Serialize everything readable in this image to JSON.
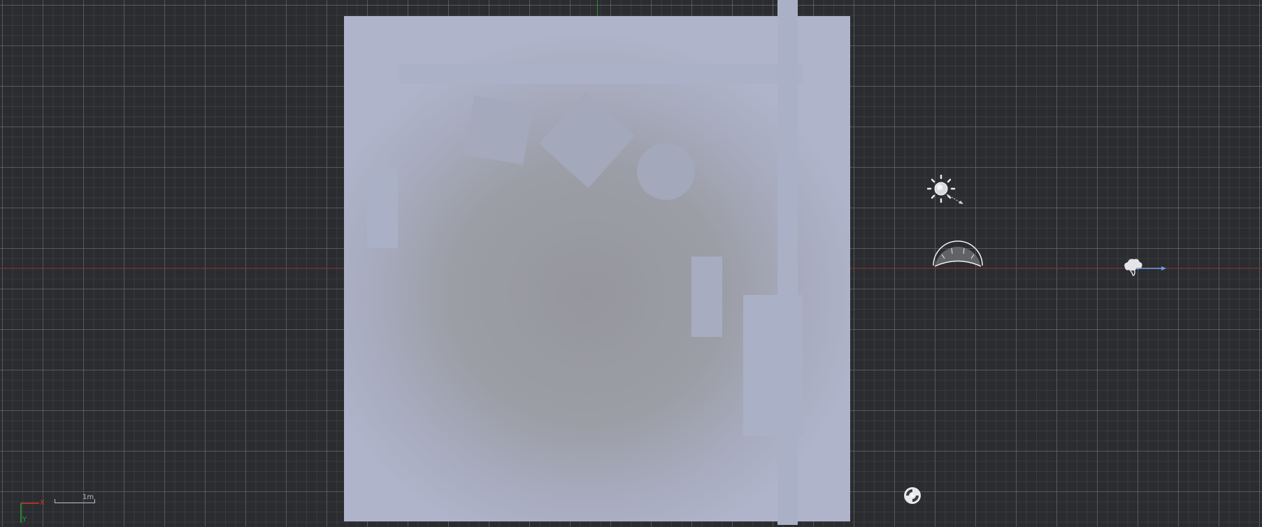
{
  "viewport": {
    "grid": "on",
    "colors": {
      "background": "#2b2c2f",
      "grid_line": "#5a5c61",
      "x_axis": "#7a2a2e",
      "y_axis": "#2f8f3a",
      "room_surface": "#a8acbf",
      "gizmo_x": "#d9342b",
      "gizmo_y": "#2fa23a",
      "wind_arrow": "#6f9be0"
    }
  },
  "scene": {
    "room": {
      "name": "room-floor"
    },
    "objects": [
      "top-shelf",
      "square-table",
      "rotated-box",
      "round-object",
      "left-cabinet",
      "right-small-box",
      "right-cabinet",
      "vertical-wall-strip"
    ],
    "lights": [
      {
        "icon": "sun-light-icon"
      },
      {
        "icon": "dome-light-icon"
      },
      {
        "icon": "wind-icon"
      },
      {
        "icon": "sphere-probe-icon"
      }
    ]
  },
  "orientation_gizmo": {
    "x_label": "X",
    "y_label": "Y"
  },
  "scale_bar": {
    "label": "1m"
  }
}
